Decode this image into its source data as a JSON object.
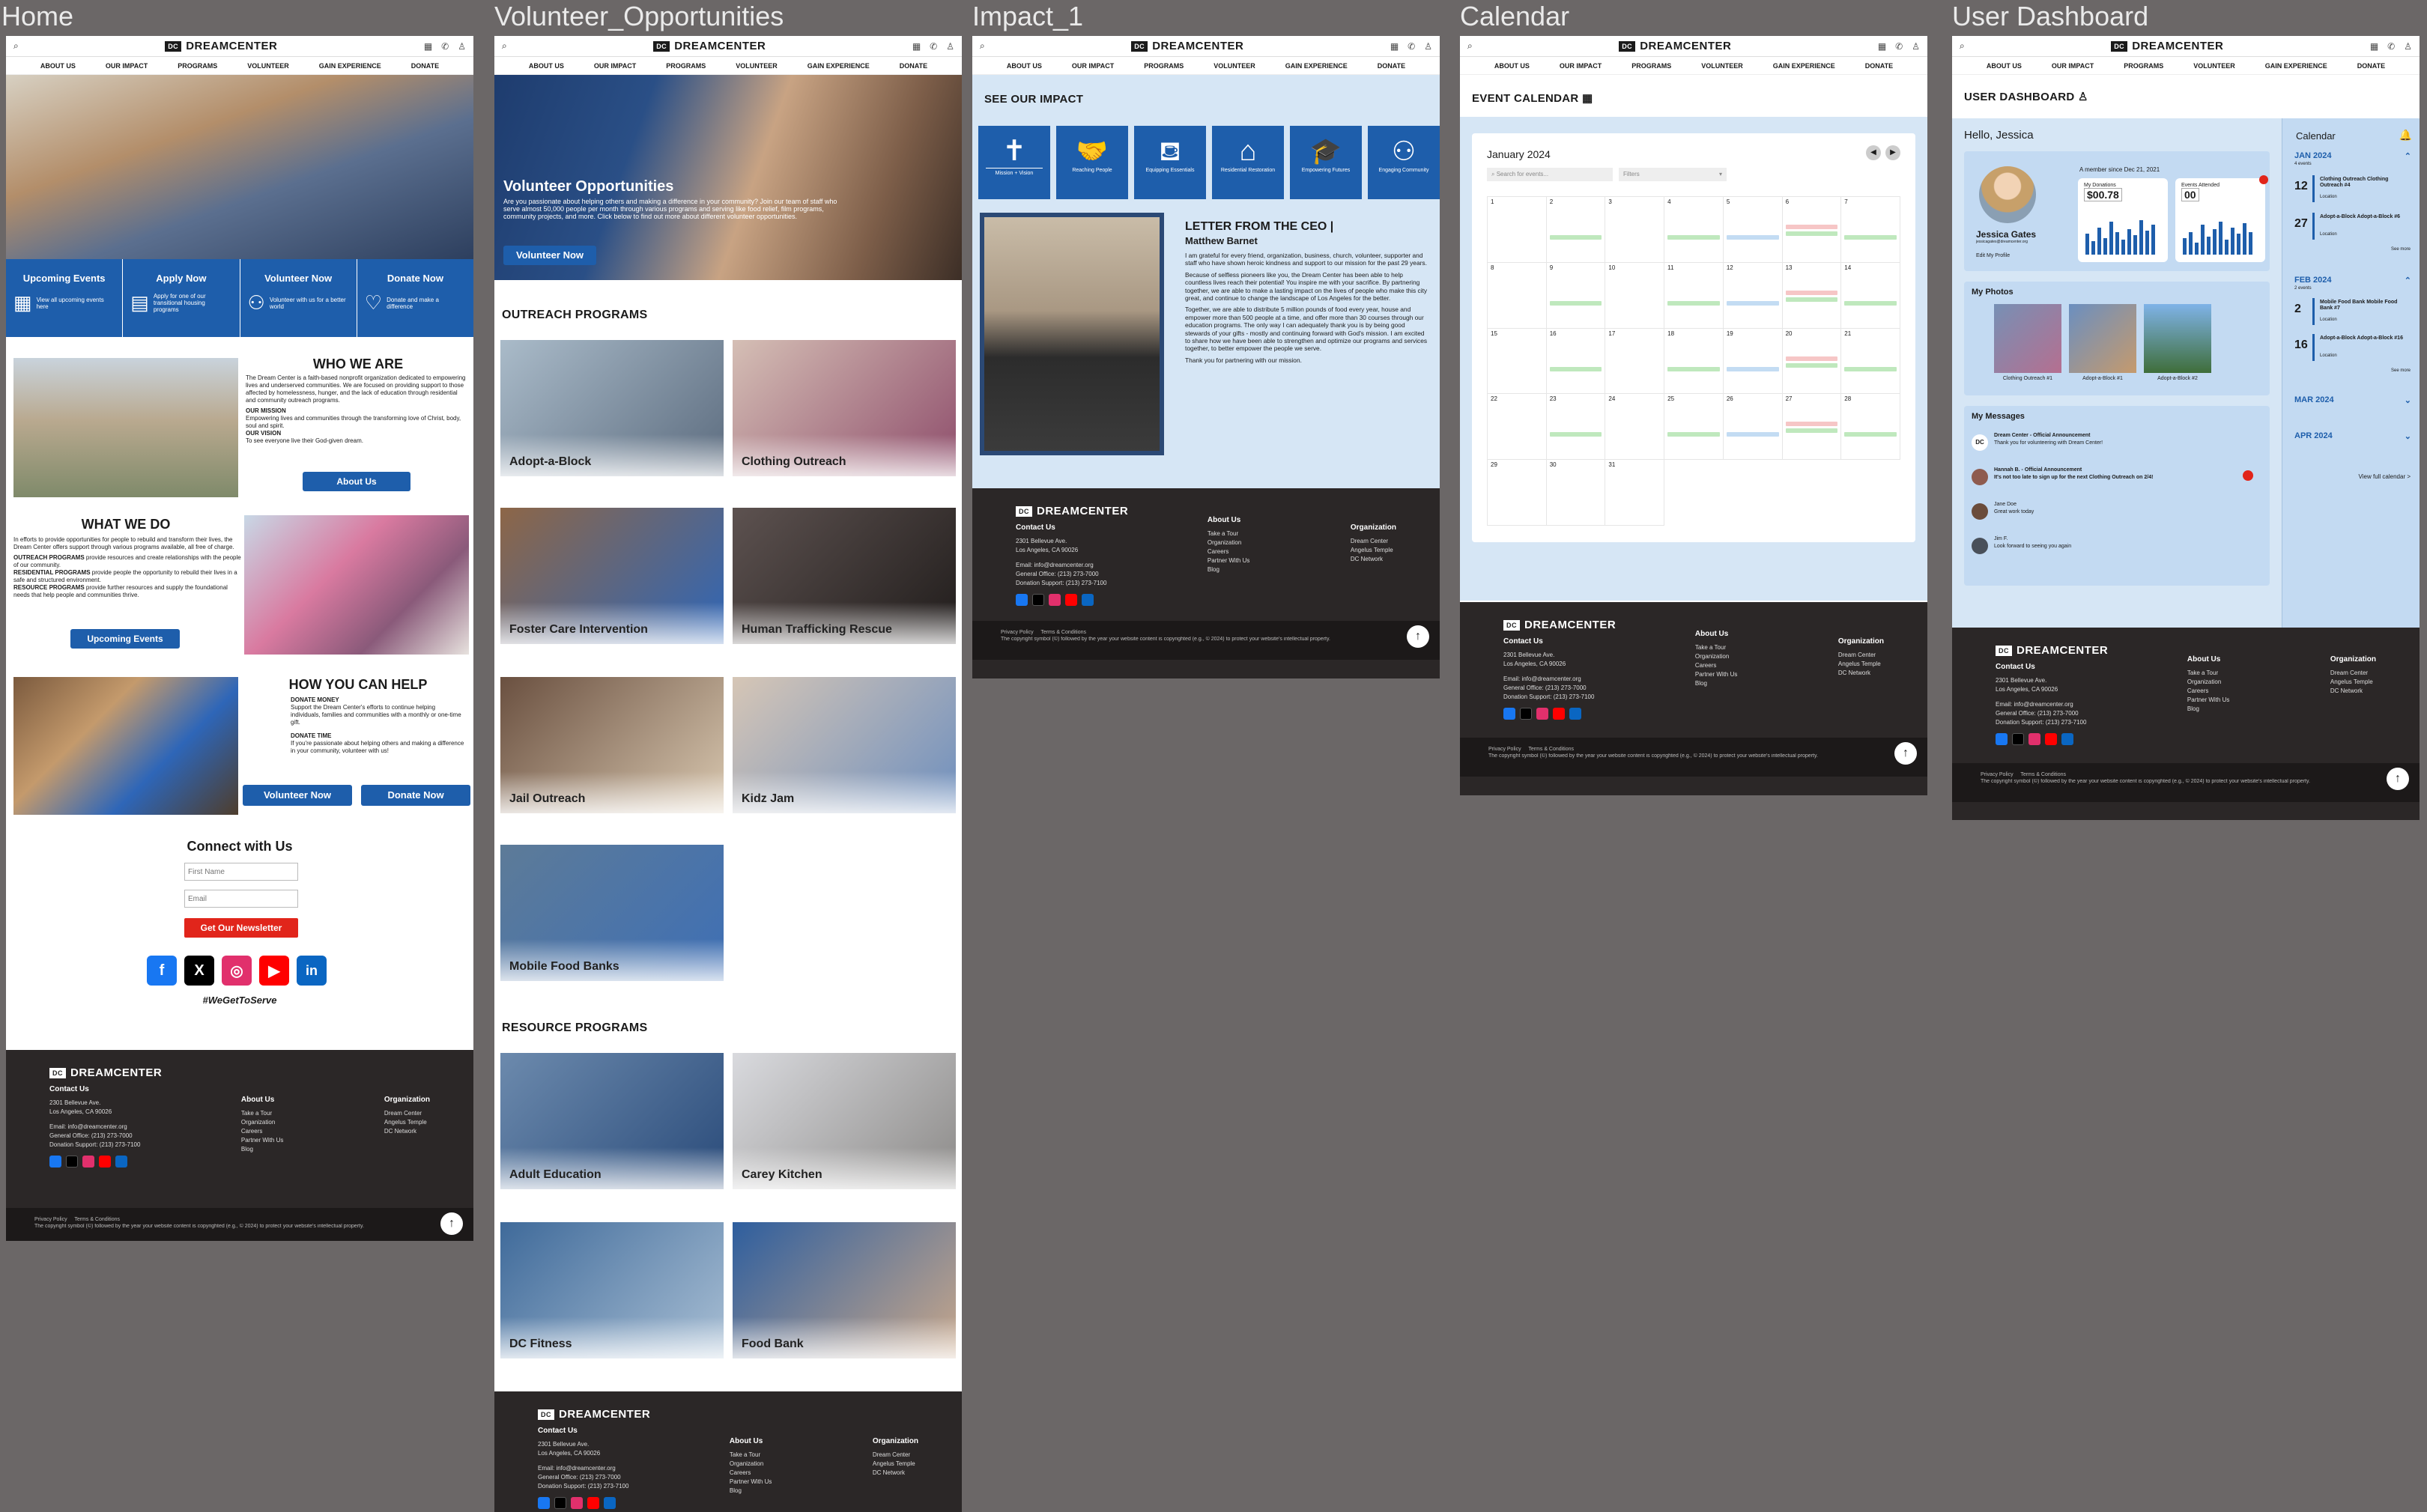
{
  "frames": {
    "home": "Home",
    "volunteer": "Volunteer_Opportunities",
    "impact": "Impact_1",
    "calendar": "Calendar",
    "dashboard": "User Dashboard"
  },
  "brand": "DREAMCENTER",
  "nav": [
    "ABOUT US",
    "OUR IMPACT",
    "PROGRAMS",
    "VOLUNTEER",
    "GAIN EXPERIENCE",
    "DONATE"
  ],
  "home": {
    "cards": [
      {
        "title": "Upcoming Events",
        "text": "View all upcoming events here"
      },
      {
        "title": "Apply Now",
        "text": "Apply for one of our transitional housing programs"
      },
      {
        "title": "Volunteer Now",
        "text": "Volunteer with us for a better world"
      },
      {
        "title": "Donate Now",
        "text": "Donate and make a difference"
      }
    ],
    "who_title": "WHO WE ARE",
    "who_text": "The Dream Center is a faith-based nonprofit organization dedicated to empowering lives and underserved communities. We are focused on providing support to those affected by homelessness, hunger, and the lack of education through residential and community outreach programs.",
    "mission_label": "OUR MISSION",
    "mission_text": "Empowering lives and communities through the transforming love of Christ, body, soul and spirit.",
    "vision_label": "OUR VISION",
    "vision_text": "To see everyone live their God-given dream.",
    "about_btn": "About Us",
    "what_title": "WHAT WE DO",
    "what_text": "In efforts to provide opportunities for people to rebuild and transform their lives, the Dream Center offers support through various programs available, all free of charge.",
    "outreach_label": "OUTREACH PROGRAMS",
    "outreach_text": "provide resources and create relationships with the people of our community.",
    "residential_label": "RESIDENTIAL PROGRAMS",
    "residential_text": "provide people the opportunity to rebuild their lives in a safe and structured environment.",
    "resource_label": "RESOURCE PROGRAMS",
    "resource_text": "provide further resources and supply the foundational needs that help people and communities thrive.",
    "events_btn": "Upcoming Events",
    "help_title": "HOW YOU CAN HELP",
    "donate_money_label": "DONATE MONEY",
    "donate_money_text": "Support the Dream Center's efforts to continue helping individuals, families and communities with a monthly or one-time gift.",
    "donate_time_label": "DONATE TIME",
    "donate_time_text": "If you're passionate about helping others and making a difference in your community, volunteer with us!",
    "volunteer_btn": "Volunteer Now",
    "donate_btn": "Donate Now",
    "connect_title": "Connect with Us",
    "first_name_ph": "First Name",
    "email_ph": "Email",
    "newsletter_btn": "Get Our Newsletter",
    "hashtag": "#WeGetToServe"
  },
  "volunteer": {
    "hero_title": "Volunteer Opportunities",
    "hero_text": "Are you passionate about helping others and making a difference in your community? Join our team of staff who serve almost 50,000 people per month through various programs and serving like food relief, film programs, community projects, and more. Click below to find out more about different volunteer opportunities.",
    "hero_btn": "Volunteer Now",
    "outreach_title": "OUTREACH PROGRAMS",
    "outreach": [
      "Adopt-a-Block",
      "Clothing Outreach",
      "Foster Care Intervention",
      "Human Trafficking Rescue",
      "Jail Outreach",
      "Kidz Jam",
      "Mobile Food Banks"
    ],
    "resource_title": "RESOURCE PROGRAMS",
    "resource": [
      "Adult Education",
      "Carey Kitchen",
      "DC Fitness",
      "Food Bank"
    ]
  },
  "impact": {
    "title": "SEE OUR IMPACT",
    "icons": [
      {
        "label": "Mission + Vision",
        "icon": "cross-icon"
      },
      {
        "label": "Reaching People",
        "icon": "handshake-icon"
      },
      {
        "label": "Equipping Essentials",
        "icon": "bag-icon"
      },
      {
        "label": "Residential Restoration",
        "icon": "house-icon"
      },
      {
        "label": "Empowering Futures",
        "icon": "graduation-icon"
      },
      {
        "label": "Engaging Community",
        "icon": "people-icon"
      }
    ],
    "letter_title": "LETTER FROM THE CEO |",
    "ceo_name": "Matthew Barnet",
    "p1": "I am grateful for every friend, organization, business, church, volunteer, supporter and staff who have shown heroic kindness and support to our mission for the past 29 years.",
    "p2": "Because of selfless pioneers like you, the Dream Center has been able to help countless lives reach their potential! You inspire me with your sacrifice. By partnering together, we are able to make a lasting impact on the lives of people who make this city great, and continue to change the landscape of Los Angeles for the better.",
    "p3": "Together, we are able to distribute 5 million pounds of food every year, house and empower more than 500 people at a time, and offer more than 30 courses through our education programs. The only way I can adequately thank you is by being good stewards of your gifts - mostly and continuing forward with God's mission. I am excited to share how we have been able to strengthen and optimize our programs and services together, to better empower the people we serve.",
    "p4": "Thank you for partnering with our mission."
  },
  "calendar": {
    "title": "EVENT CALENDAR",
    "month": "January 2024",
    "search_ph": "Search for events...",
    "filters": "Filters",
    "days": [
      "1",
      "2",
      "3",
      "4",
      "5",
      "6",
      "7",
      "8",
      "9",
      "10",
      "11",
      "12",
      "13",
      "14",
      "15",
      "16",
      "17",
      "18",
      "19",
      "20",
      "21",
      "22",
      "23",
      "24",
      "25",
      "26",
      "27",
      "28",
      "29",
      "30",
      "31"
    ]
  },
  "dashboard": {
    "title": "USER DASHBOARD",
    "hello": "Hello, Jessica",
    "member_since": "A member since Dec 21, 2021",
    "name": "Jessica Gates",
    "handle": "jessicagates@dreamcenter.org",
    "edit": "Edit My Profile",
    "donations_label": "My Donations",
    "donations_value": "$00.78",
    "events_label": "Events Attended",
    "events_value": "00",
    "photos_title": "My Photos",
    "photos": [
      "Clothing Outreach #1",
      "Adopt-a-Block #1",
      "Adopt-a-Block #2"
    ],
    "messages_title": "My Messages",
    "messages": [
      {
        "from": "Dream Center - Official Announcement",
        "text": "Thank you for volunteering with Dream Center!"
      },
      {
        "from": "Hannah B. - Official Announcement",
        "text": "It's not too late to sign up for the next Clothing Outreach on 2/4!"
      },
      {
        "from": "Jane Doe",
        "text": "Great work today"
      },
      {
        "from": "Jim F.",
        "text": "Look forward to seeing you again"
      }
    ],
    "cal_title": "Calendar",
    "jan": "JAN 2024",
    "jan_sub": "4 events",
    "jan_events": [
      {
        "day": "12",
        "title": "Clothing Outreach Clothing Outreach #4",
        "loc": "Location"
      },
      {
        "day": "27",
        "title": "Adopt-a-Block Adopt-a-Block #6",
        "loc": "Location"
      }
    ],
    "feb": "FEB 2024",
    "feb_sub": "2 events",
    "feb_events": [
      {
        "day": "2",
        "title": "Mobile Food Bank Mobile Food Bank #7",
        "loc": "Location"
      },
      {
        "day": "16",
        "title": "Adopt-a-Block Adopt-a-Block #16",
        "loc": "Location"
      }
    ],
    "see_more": "See more",
    "mar": "MAR 2024",
    "apr": "APR 2024",
    "view_full": "View full calendar >"
  },
  "footer": {
    "contact_title": "Contact Us",
    "address1": "2301 Bellevue Ave.",
    "address2": "Los Angeles, CA 90026",
    "email": "Email: info@dreamcenter.org",
    "office": "General Office: (213) 273-7000",
    "donation": "Donation Support: (213) 273-7100",
    "about_title": "About Us",
    "about_links": [
      "Take a Tour",
      "Organization",
      "Careers",
      "Partner With Us",
      "Blog"
    ],
    "org_title": "Organization",
    "org_links": [
      "Dream Center",
      "Angelus Temple",
      "DC Network"
    ],
    "privacy": "Privacy Policy",
    "terms": "Terms & Conditions",
    "copyright": "The copyright symbol (©) followed by the year your website content is copyrighted (e.g., © 2024) to protect your website's intellectual property."
  },
  "social_colors": [
    "#1877f2",
    "#000000",
    "#e1306c",
    "#ff0000",
    "#0a66c2"
  ]
}
